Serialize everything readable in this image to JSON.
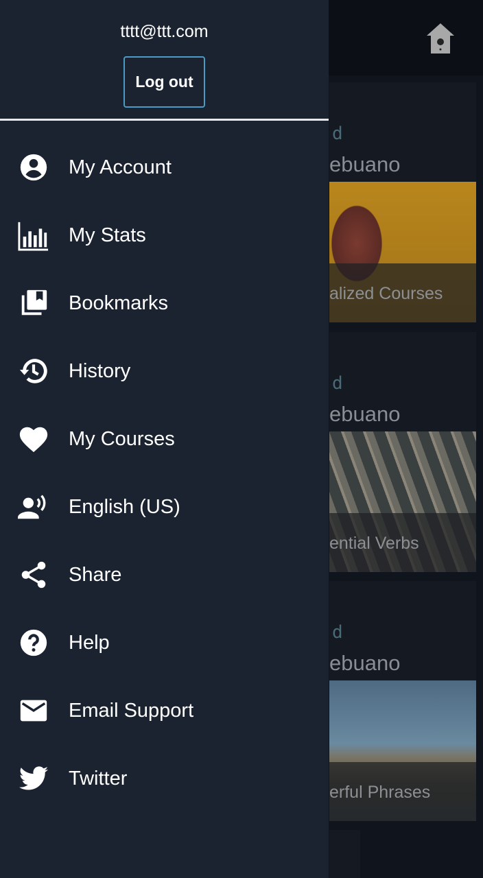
{
  "drawer": {
    "email": "tttt@ttt.com",
    "logout_label": "Log out",
    "items": [
      {
        "label": "My Account",
        "icon": "account-circle-icon"
      },
      {
        "label": "My Stats",
        "icon": "bar-chart-icon"
      },
      {
        "label": "Bookmarks",
        "icon": "bookmarks-icon"
      },
      {
        "label": "History",
        "icon": "history-icon"
      },
      {
        "label": "My Courses",
        "icon": "heart-icon"
      },
      {
        "label": "English (US)",
        "icon": "voice-person-icon"
      },
      {
        "label": "Share",
        "icon": "share-icon"
      },
      {
        "label": "Help",
        "icon": "help-circle-icon"
      },
      {
        "label": "Email Support",
        "icon": "mail-icon"
      },
      {
        "label": "Twitter",
        "icon": "twitter-icon"
      }
    ]
  },
  "background": {
    "home_icon": "birdhouse-home-icon",
    "cards": [
      {
        "level": "d",
        "language": "ebuano",
        "caption": "alized Courses"
      },
      {
        "level": "d",
        "language": "ebuano",
        "caption": "ential Verbs"
      },
      {
        "level": "d",
        "language": "ebuano",
        "caption": "erful Phrases"
      }
    ]
  },
  "colors": {
    "drawer_bg": "#1c2330",
    "accent": "#4a9cc4"
  }
}
